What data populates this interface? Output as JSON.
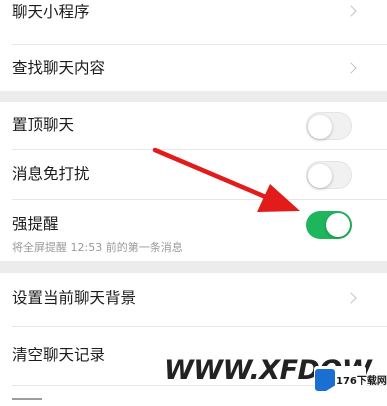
{
  "settings": {
    "mini_programs_label": "聊天小程序",
    "find_content_label": "查找聊天内容",
    "pin_chat_label": "置顶聊天",
    "pin_chat_on": false,
    "mute_label": "消息免打扰",
    "mute_on": false,
    "strong_reminder_label": "强提醒",
    "strong_reminder_on": true,
    "strong_reminder_sub": "将全屏提醒 12:53 前的第一条消息",
    "background_label": "设置当前聊天背景",
    "clear_history_label": "清空聊天记录"
  },
  "colors": {
    "toggle_on": "#1eb55c",
    "arrow": "#e21b1b",
    "logo_blue": "#1a6fd1"
  },
  "icons": {
    "chevron": "chevron-right-icon",
    "arrow": "red-arrow-icon"
  },
  "watermark": {
    "text": "WWW.XFDOW",
    "logo_text": "176下载网"
  }
}
